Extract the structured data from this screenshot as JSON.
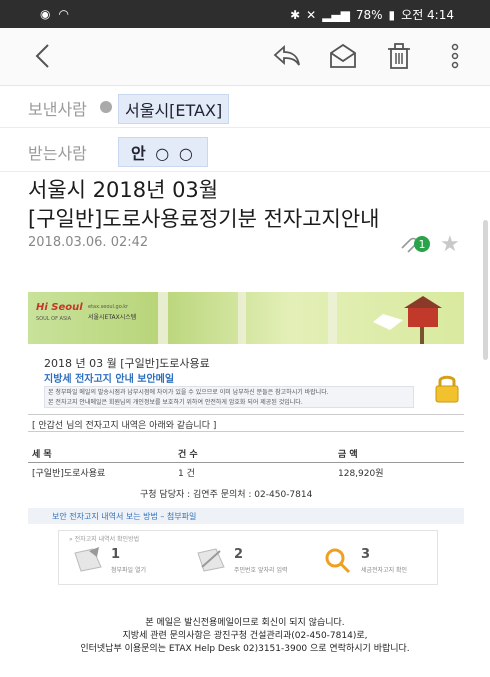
{
  "status_bar": {
    "battery": "78%",
    "time": "오전 4:14"
  },
  "app_bar": {
    "icons": [
      "back-arrow-icon",
      "reply-icon",
      "mark-unread-icon",
      "trash-icon",
      "more-vert-icon"
    ]
  },
  "sender": {
    "label": "보낸사람",
    "name": "서울시[ETAX]"
  },
  "recipient": {
    "label": "받는사람",
    "name": "안 ○ ○"
  },
  "subject": {
    "line1": "서울시 2018년 03월",
    "line2": "[구일반]도로사용료정기분 전자고지안내"
  },
  "date": "2018.03.06. 02:42",
  "attachment_count": "1",
  "email": {
    "banner": {
      "logo": "Hi Seoul",
      "logo_sub": "SOUL OF ASIA",
      "site": "etax.seoul.go.kr",
      "brand": "서울시ETAX시스템"
    },
    "heading": "2018 년 03 월 [구일반]도로사용료",
    "subheading": "지방세 전자고지 안내 보안메일",
    "notice_lines": [
      "본 청부파일 메일의 발송시점과 납부시점에 차이가 있을 수 있으므로 이미 납부하신 분들은 참고하시기 바랍니다.",
      "본 전자고지 안내메일은 회원님의 개인정보를 보호하기 위하여 안전하게 암호화 되어 제공된 것입니다."
    ],
    "intro": "[ 안갑선 님의 전자고지 내역은 아래와 같습니다 ]",
    "table": {
      "headers": [
        "세 목",
        "건 수",
        "금 액"
      ],
      "rows": [
        [
          "[구일반]도로사용료",
          "1 건",
          "128,920원"
        ]
      ]
    },
    "officer": "구청 담당자 : 김연주     문의처 : 02-450-7814",
    "guide_title": "보안 전자고지 내역서 보는 방법 – 첨부파일",
    "guide_caption": "» 전자고지 내역서 확인방법",
    "steps": [
      {
        "num": "1",
        "text": "첨부파일 열기"
      },
      {
        "num": "2",
        "text": "주민번호 앞자리 입력"
      },
      {
        "num": "3",
        "text": "세금전자고지 확인"
      }
    ]
  },
  "footer": {
    "line1": "본 메일은 발신전용메일이므로 회신이 되지 않습니다.",
    "line2": "지방세 관련 문의사항은 광진구청 건설관리과(02-450-7814)로,",
    "line3": "인터넷납부 이용문의는 ETAX Help Desk 02)3151-3900 으로 연락하시기 바랍니다."
  }
}
